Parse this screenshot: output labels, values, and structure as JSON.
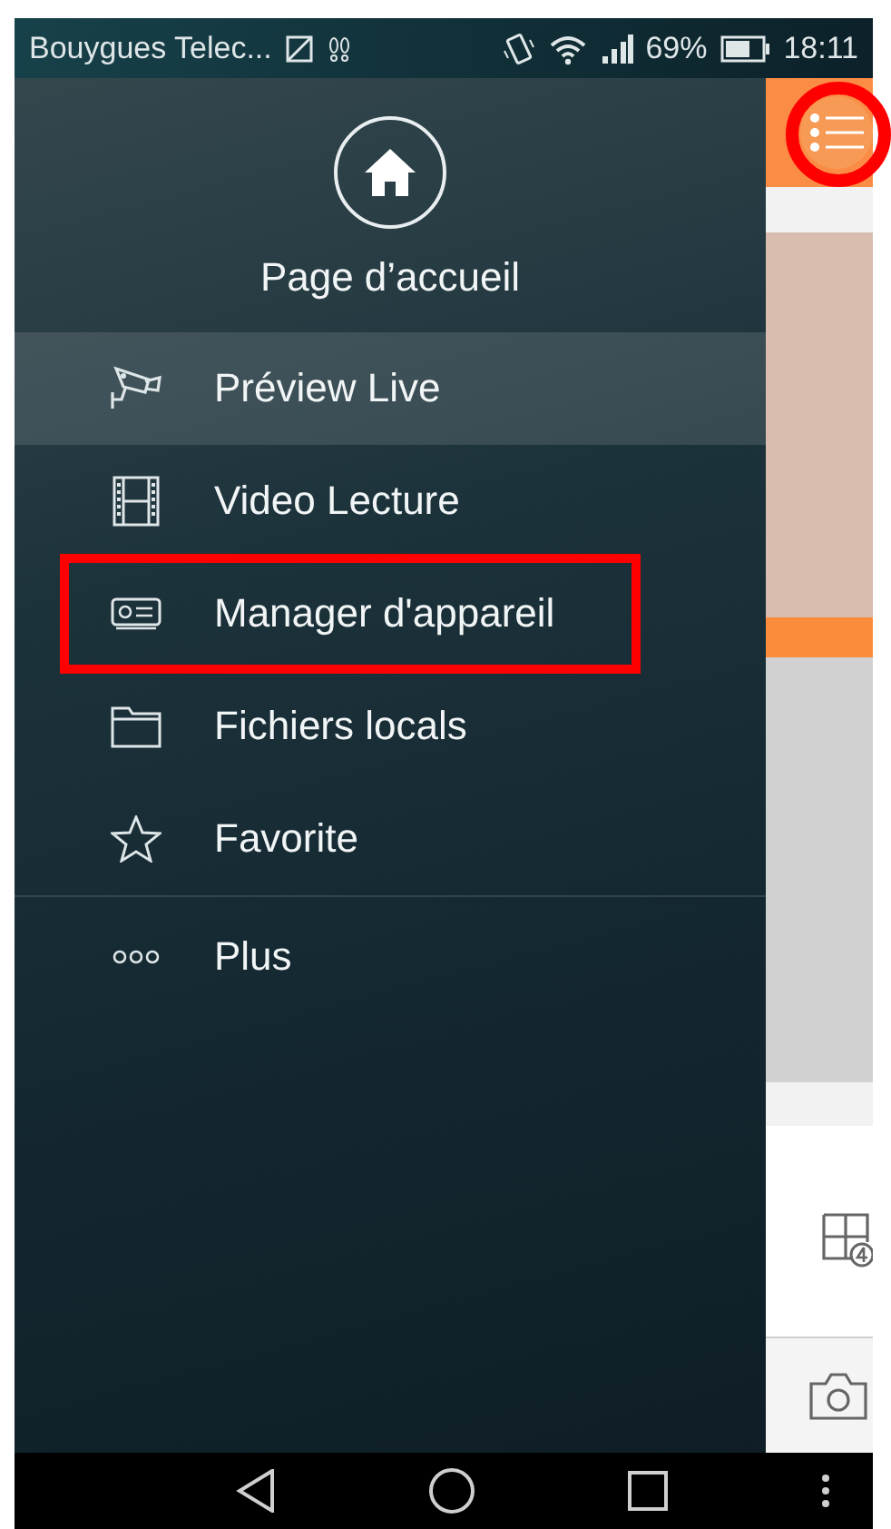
{
  "status_bar": {
    "carrier": "Bouygues Telec...",
    "battery": "69%",
    "time": "18:11"
  },
  "drawer": {
    "home_label": "Page d’accueil",
    "items": [
      {
        "kind": "camera",
        "label": "Préview Live",
        "selected": true,
        "annotated": false
      },
      {
        "kind": "film",
        "label": "Video Lecture",
        "selected": false,
        "annotated": false
      },
      {
        "kind": "device",
        "label": "Manager d'appareil",
        "selected": false,
        "annotated": true
      },
      {
        "kind": "folder",
        "label": "Fichiers locals",
        "selected": false,
        "annotated": false
      },
      {
        "kind": "star",
        "label": "Favorite",
        "selected": false,
        "annotated": false
      },
      {
        "kind": "more",
        "label": "Plus",
        "selected": false,
        "annotated": false
      }
    ]
  },
  "app": {
    "menu_button": {
      "annotated": true
    }
  }
}
